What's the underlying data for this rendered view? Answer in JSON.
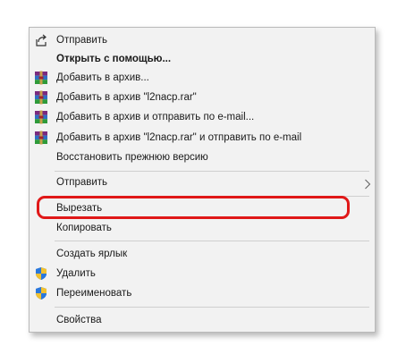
{
  "menu": {
    "share": "Отправить",
    "open_with": "Открыть с помощью...",
    "add_archive": "Добавить в архив...",
    "add_named_archive": "Добавить в архив \"l2nacp.rar\"",
    "add_archive_email": "Добавить в архив и отправить по e-mail...",
    "add_named_archive_email": "Добавить в архив \"l2nacp.rar\" и отправить по e-mail",
    "restore": "Восстановить прежнюю версию",
    "send_to": "Отправить",
    "cut": "Вырезать",
    "copy": "Копировать",
    "create_shortcut": "Создать ярлык",
    "delete": "Удалить",
    "rename": "Переименовать",
    "properties": "Свойства"
  },
  "icons": {
    "share": "share-icon",
    "winrar": "winrar-icon",
    "shield": "uac-shield-icon",
    "submenu": "chevron-right-icon"
  },
  "colors": {
    "menu_background": "#f2f2f2",
    "highlight": "#e01818"
  }
}
